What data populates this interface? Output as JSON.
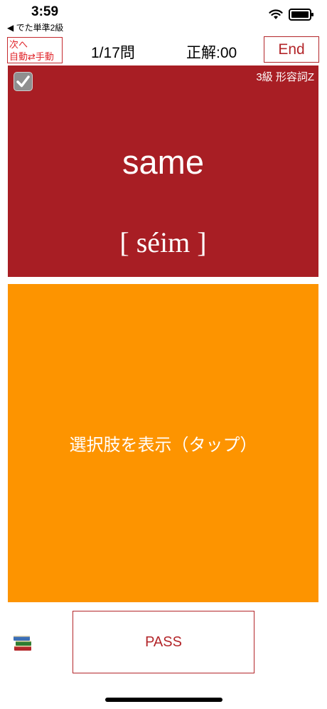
{
  "status_bar": {
    "time": "3:59",
    "back_app": "◀ でた単準2級"
  },
  "nav": {
    "next_mode_label_1": "次へ",
    "next_mode_label_2": "自動⇄手動",
    "progress": "1/17問",
    "score": "正解:00",
    "end_label": "End"
  },
  "word_card": {
    "level_tag": "3級  形容詞Z",
    "word": "same",
    "pronunciation": "[ séim ]"
  },
  "choices_card": {
    "label": "選択肢を表示（タップ）"
  },
  "footer": {
    "pass_label": "PASS"
  },
  "colors": {
    "card_red": "#a81e24",
    "choices_orange": "#fd9400",
    "accent_red": "#b3262a"
  },
  "icons": [
    "wifi-icon",
    "battery-icon",
    "checkbox-icon",
    "books-icon"
  ]
}
